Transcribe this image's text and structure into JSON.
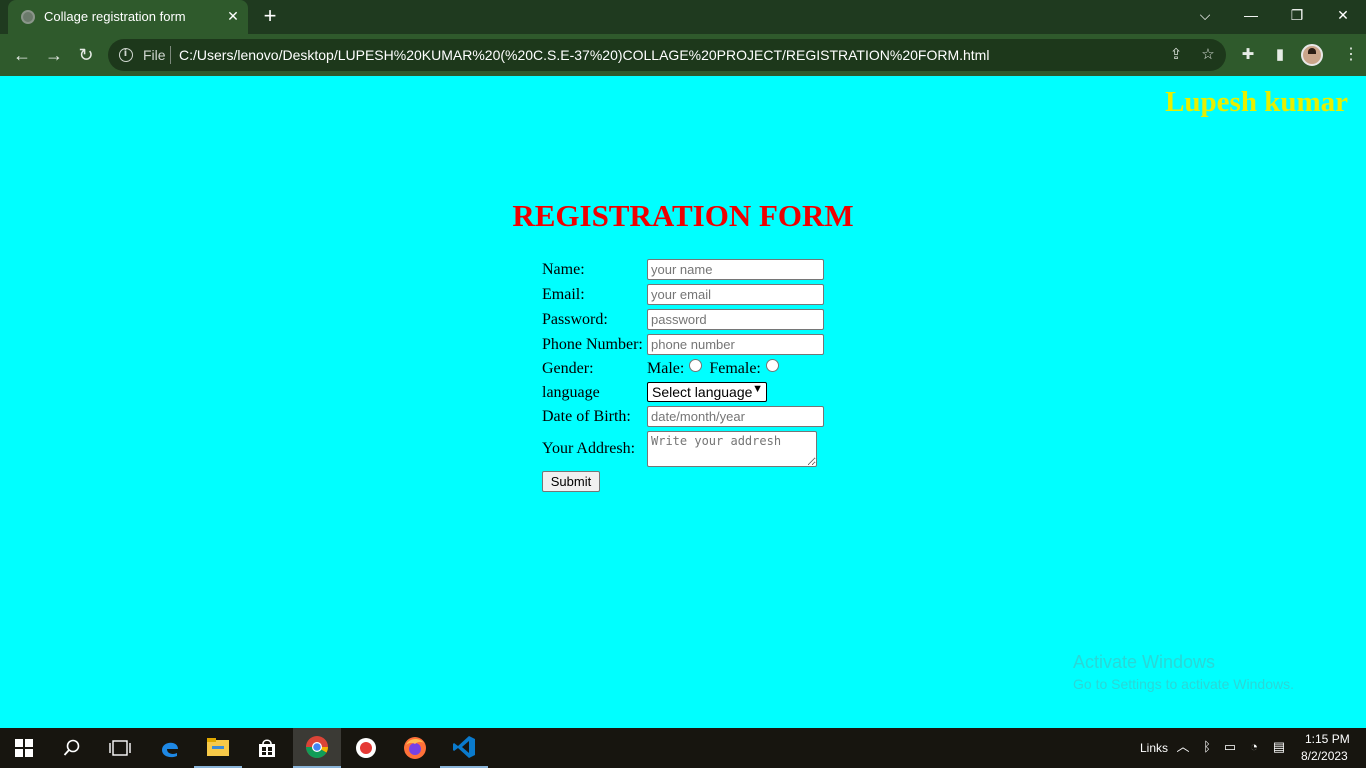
{
  "browser": {
    "tab_title": "Collage registration form",
    "scheme_label": "File",
    "url": "C:/Users/lenovo/Desktop/LUPESH%20KUMAR%20(%20C.S.E-37%20)COLLAGE%20PROJECT/REGISTRATION%20FORM.html",
    "icons": [
      "back-icon",
      "forward-icon",
      "reload-icon",
      "info-icon",
      "share-icon",
      "star-icon",
      "extensions-icon",
      "side-panel-icon",
      "profile-avatar",
      "menu-icon"
    ]
  },
  "page": {
    "background": "#00ffff",
    "author": "Lupesh kumar",
    "author_color": "#e8ef00",
    "title": "REGISTRATION FORM",
    "title_color": "#ee0000",
    "form": {
      "name_label": "Name:",
      "name_placeholder": "your name",
      "email_label": "Email:",
      "email_placeholder": "your email",
      "password_label": "Password:",
      "password_placeholder": "password",
      "phone_label": "Phone Number:",
      "phone_placeholder": "phone number",
      "gender_label": "Gender:",
      "male_label": "Male:",
      "female_label": "Female:",
      "language_label": "language",
      "language_selected": "Select language",
      "dob_label": "Date of Birth:",
      "dob_placeholder": "date/month/year",
      "address_label": "Your Addresh:",
      "address_placeholder": "Write your addresh",
      "submit_label": "Submit"
    },
    "watermark_title": "Activate Windows",
    "watermark_subtitle": "Go to Settings to activate Windows."
  },
  "taskbar": {
    "apps": [
      "windows-start-icon",
      "search-icon",
      "task-view-icon",
      "edge-icon",
      "file-explorer-icon",
      "store-icon",
      "chrome-icon",
      "record-icon",
      "firefox-icon",
      "vscode-icon"
    ],
    "links_label": "Links",
    "time": "1:15 PM",
    "date": "8/2/2023"
  }
}
